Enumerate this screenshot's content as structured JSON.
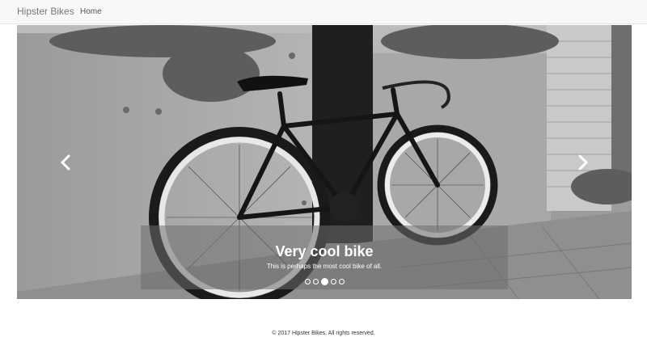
{
  "navbar": {
    "brand": "Hipster Bikes",
    "items": [
      {
        "label": "Home"
      }
    ]
  },
  "carousel": {
    "slide_count": 5,
    "active_index": 2,
    "caption": {
      "title": "Very cool bike",
      "text": "This is perhaps the most cool bike of all."
    },
    "prev_icon": "chevron-left-icon",
    "next_icon": "chevron-right-icon"
  },
  "footer": {
    "text": "© 2017 Hipster Bikes. All rights reserved."
  }
}
